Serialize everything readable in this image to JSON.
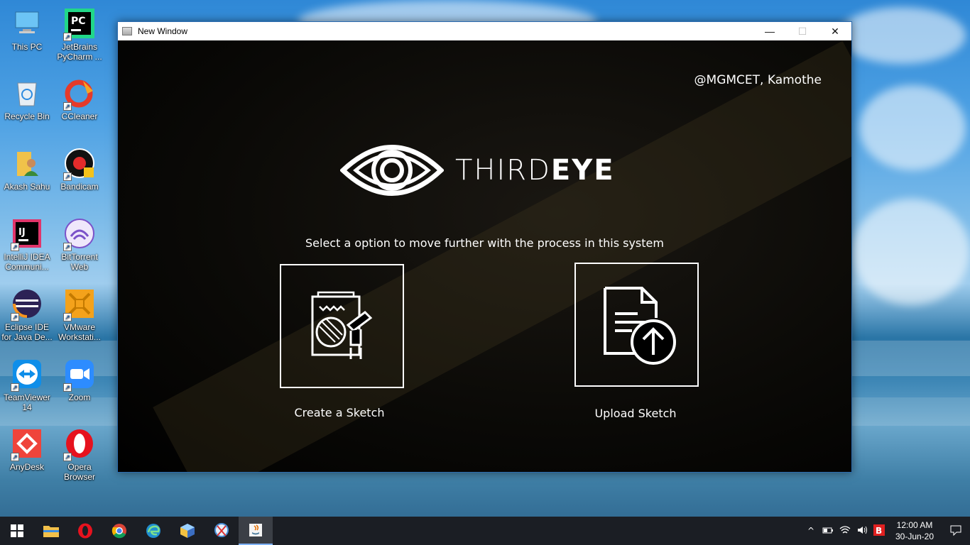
{
  "desktop": {
    "icons": [
      {
        "label": "This PC",
        "icon": "computer-icon"
      },
      {
        "label": "JetBrains\nPyCharm ...",
        "icon": "pycharm-icon"
      },
      {
        "label": "Recycle Bin",
        "icon": "recycle-bin-icon"
      },
      {
        "label": "CCleaner",
        "icon": "ccleaner-icon"
      },
      {
        "label": "Akash Sahu",
        "icon": "user-folder-icon"
      },
      {
        "label": "Bandicam",
        "icon": "bandicam-icon"
      },
      {
        "label": "IntelliJ IDEA\nCommuni...",
        "icon": "intellij-icon"
      },
      {
        "label": "BitTorrent\nWeb",
        "icon": "bittorrent-icon"
      },
      {
        "label": "Eclipse IDE\nfor Java De...",
        "icon": "eclipse-icon"
      },
      {
        "label": "VMware\nWorkstati...",
        "icon": "vmware-icon"
      },
      {
        "label": "TeamViewer\n14",
        "icon": "teamviewer-icon"
      },
      {
        "label": "Zoom",
        "icon": "zoom-icon"
      },
      {
        "label": "AnyDesk",
        "icon": "anydesk-icon"
      },
      {
        "label": "Opera\nBrowser",
        "icon": "opera-icon"
      }
    ]
  },
  "window": {
    "title": "New Window",
    "minimize": "—",
    "maximize": "☐",
    "close": "✕"
  },
  "app": {
    "credit": "@MGMCET, Kamothe",
    "brand_light": "THIRD",
    "brand_bold": "EYE",
    "prompt": "Select a option to move further with the process in this system",
    "options": [
      {
        "label": "Create a Sketch",
        "icon": "sketch-drawing-icon"
      },
      {
        "label": "Upload Sketch",
        "icon": "upload-document-icon"
      }
    ]
  },
  "taskbar": {
    "apps": [
      "start-icon",
      "file-explorer-icon",
      "opera-icon",
      "chrome-icon",
      "edge-dev-icon",
      "virtualbox-icon",
      "snipping-tool-icon",
      "java-icon"
    ],
    "tray": {
      "chevron": "^",
      "time": "12:00 AM",
      "date": "30-Jun-20"
    }
  },
  "colors": {
    "window_bg": "#000000",
    "text": "#ffffff",
    "taskbar": "#1b1e24"
  }
}
